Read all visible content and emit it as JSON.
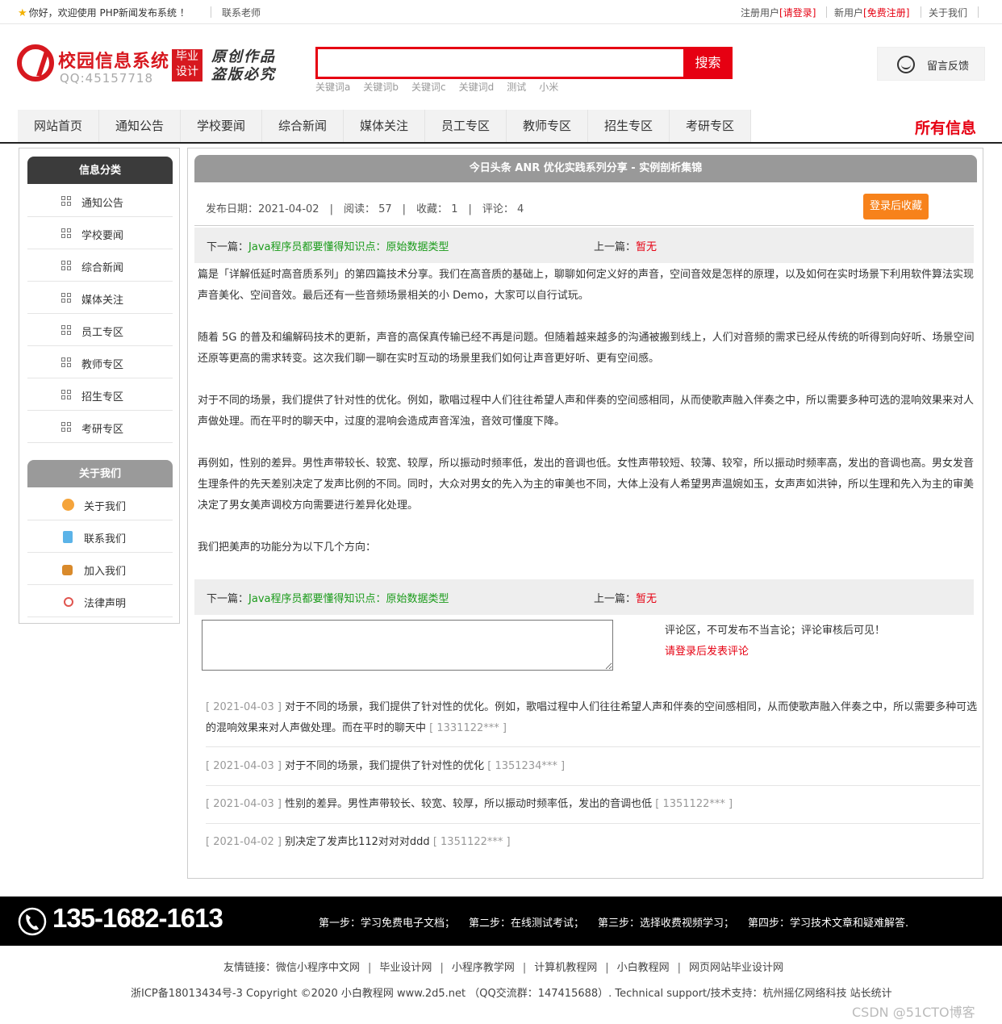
{
  "topbar": {
    "welcome": "你好，欢迎使用 PHP新闻发布系统 ！",
    "contact": "联系老师",
    "registered_prefix": "注册用户",
    "login_link": "[请登录]",
    "new_prefix": "新用户",
    "register_link": "[免费注册]",
    "about": "关于我们"
  },
  "header": {
    "site_title": "校园信息系统",
    "qq": "QQ:45157718",
    "badge_top": "毕业",
    "badge_bottom": "设计",
    "slogan_top": "原创作品",
    "slogan_bottom": "盗版必究",
    "search_placeholder": "",
    "search_button": "搜索",
    "keywords": [
      "关键词a",
      "关键词b",
      "关键词c",
      "关键词d",
      "测试",
      "小米"
    ],
    "feedback": "留言反馈"
  },
  "nav": {
    "items": [
      "网站首页",
      "通知公告",
      "学校要闻",
      "综合新闻",
      "媒体关注",
      "员工专区",
      "教师专区",
      "招生专区",
      "考研专区"
    ],
    "all_info": "所有信息"
  },
  "sidebar": {
    "category_title": "信息分类",
    "categories": [
      "通知公告",
      "学校要闻",
      "综合新闻",
      "媒体关注",
      "员工专区",
      "教师专区",
      "招生专区",
      "考研专区"
    ],
    "about_title": "关于我们",
    "about_items": [
      "关于我们",
      "联系我们",
      "加入我们",
      "法律声明"
    ]
  },
  "article": {
    "title": "今日头条 ANR 优化实践系列分享 - 实例剖析集锦",
    "date_label": "发布日期：2021-04-02",
    "read_label": "阅读：",
    "read_count": "57",
    "fav_label": "收藏：",
    "fav_count": "1",
    "comment_label": "评论：",
    "comment_count": "4",
    "fav_button": "登录后收藏",
    "next_label": "下一篇：",
    "next_title": "Java程序员都要懂得知识点：原始数据类型",
    "prev_label": "上一篇：",
    "prev_title": "暂无",
    "paragraphs": [
      "篇是「详解低延时高音质系列」的第四篇技术分享。我们在高音质的基础上，聊聊如何定义好的声音，空间音效是怎样的原理，以及如何在实时场景下利用软件算法实现声音美化、空间音效。最后还有一些音频场景相关的小 Demo，大家可以自行试玩。",
      "随着 5G 的普及和编解码技术的更新，声音的高保真传输已经不再是问题。但随着越来越多的沟通被搬到线上，人们对音频的需求已经从传统的听得到向好听、场景空间还原等更高的需求转变。这次我们聊一聊在实时互动的场景里我们如何让声音更好听、更有空间感。",
      "对于不同的场景，我们提供了针对性的优化。例如，歌唱过程中人们往往希望人声和伴奏的空间感相同，从而使歌声融入伴奏之中，所以需要多种可选的混响效果来对人声做处理。而在平时的聊天中，过度的混响会造成声音浑浊，音效可懂度下降。",
      "再例如，性别的差异。男性声带较长、较宽、较厚，所以振动时频率低，发出的音调也低。女性声带较短、较薄、较窄，所以振动时频率高，发出的音调也高。男女发音生理条件的先天差别决定了发声比例的不同。同时，大众对男女的先入为主的审美也不同，大体上没有人希望男声温婉如玉，女声声如洪钟，所以生理和先入为主的审美决定了男女美声调校方向需要进行差异化处理。",
      "我们把美声的功能分为以下几个方向："
    ]
  },
  "comments": {
    "notice": "评论区，不可发布不当言论；评论审核后可见！",
    "login_prompt": "请登录后发表评论",
    "list": [
      {
        "date": "[ 2021-04-03 ]",
        "text": "对于不同的场景，我们提供了针对性的优化。例如，歌唱过程中人们往往希望人声和伴奏的空间感相同，从而使歌声融入伴奏之中，所以需要多种可选的混响效果来对人声做处理。而在平时的聊天中",
        "user": "[ 1331122*** ]"
      },
      {
        "date": "[ 2021-04-03 ]",
        "text": "对于不同的场景，我们提供了针对性的优化",
        "user": "[ 1351234*** ]"
      },
      {
        "date": "[ 2021-04-03 ]",
        "text": "性别的差异。男性声带较长、较宽、较厚，所以振动时频率低，发出的音调也低",
        "user": "[ 1351122*** ]"
      },
      {
        "date": "[ 2021-04-02 ]",
        "text": "别决定了发声比112对对对ddd",
        "user": "[ 1351122*** ]"
      }
    ]
  },
  "footer": {
    "phone": "135-1682-1613",
    "steps": [
      "第一步：学习免费电子文档；",
      "第二步：在线测试考试；",
      "第三步：选择收费视频学习；",
      "第四步：学习技术文章和疑难解答."
    ],
    "links_label": "友情链接：",
    "links": [
      "微信小程序中文网",
      "毕业设计网",
      "小程序教学网",
      "计算机教程网",
      "小白教程网",
      "网页网站毕业设计网"
    ],
    "copyright": "浙ICP备18013434号-3 Copyright ©2020 小白教程网 www.2d5.net （QQ交流群：147415688）. Technical support/技术支持：杭州摇亿网络科技 站长统计",
    "watermark": "CSDN @51CTO博客"
  },
  "colors": {
    "accent": "#e60012",
    "orange": "#f7821b",
    "green": "#1a9b1a"
  }
}
